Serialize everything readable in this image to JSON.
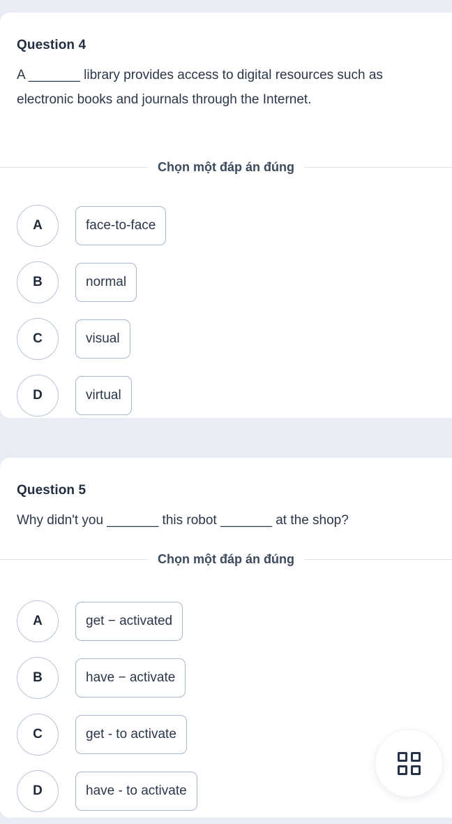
{
  "theme": {
    "page_background": "#e9edf3",
    "card_background": "#ffffff",
    "text_color": "#2b3648",
    "title_color": "#242e41",
    "option_border": "#a9b6cb",
    "circle_border": "#b9c4d6",
    "divider_line": "#dde3ec"
  },
  "questions": [
    {
      "title": "Question 4",
      "text": "A _______ library provides access to digital resources such as electronic books and journals through the Internet.",
      "instruction": "Chọn một đáp án đúng",
      "options": [
        {
          "letter": "A",
          "label": "face-to-face"
        },
        {
          "letter": "B",
          "label": "normal"
        },
        {
          "letter": "C",
          "label": "visual"
        },
        {
          "letter": "D",
          "label": "virtual"
        }
      ]
    },
    {
      "title": "Question 5",
      "text": "Why didn't you _______ this robot _______ at the shop?",
      "instruction": "Chọn một đáp án đúng",
      "options": [
        {
          "letter": "A",
          "label": "get − activated"
        },
        {
          "letter": "B",
          "label": "have − activate"
        },
        {
          "letter": "C",
          "label": "get - to activate"
        },
        {
          "letter": "D",
          "label": "have - to activate"
        }
      ]
    }
  ],
  "floating_button": {
    "icon": "grid-four-squares-icon"
  }
}
